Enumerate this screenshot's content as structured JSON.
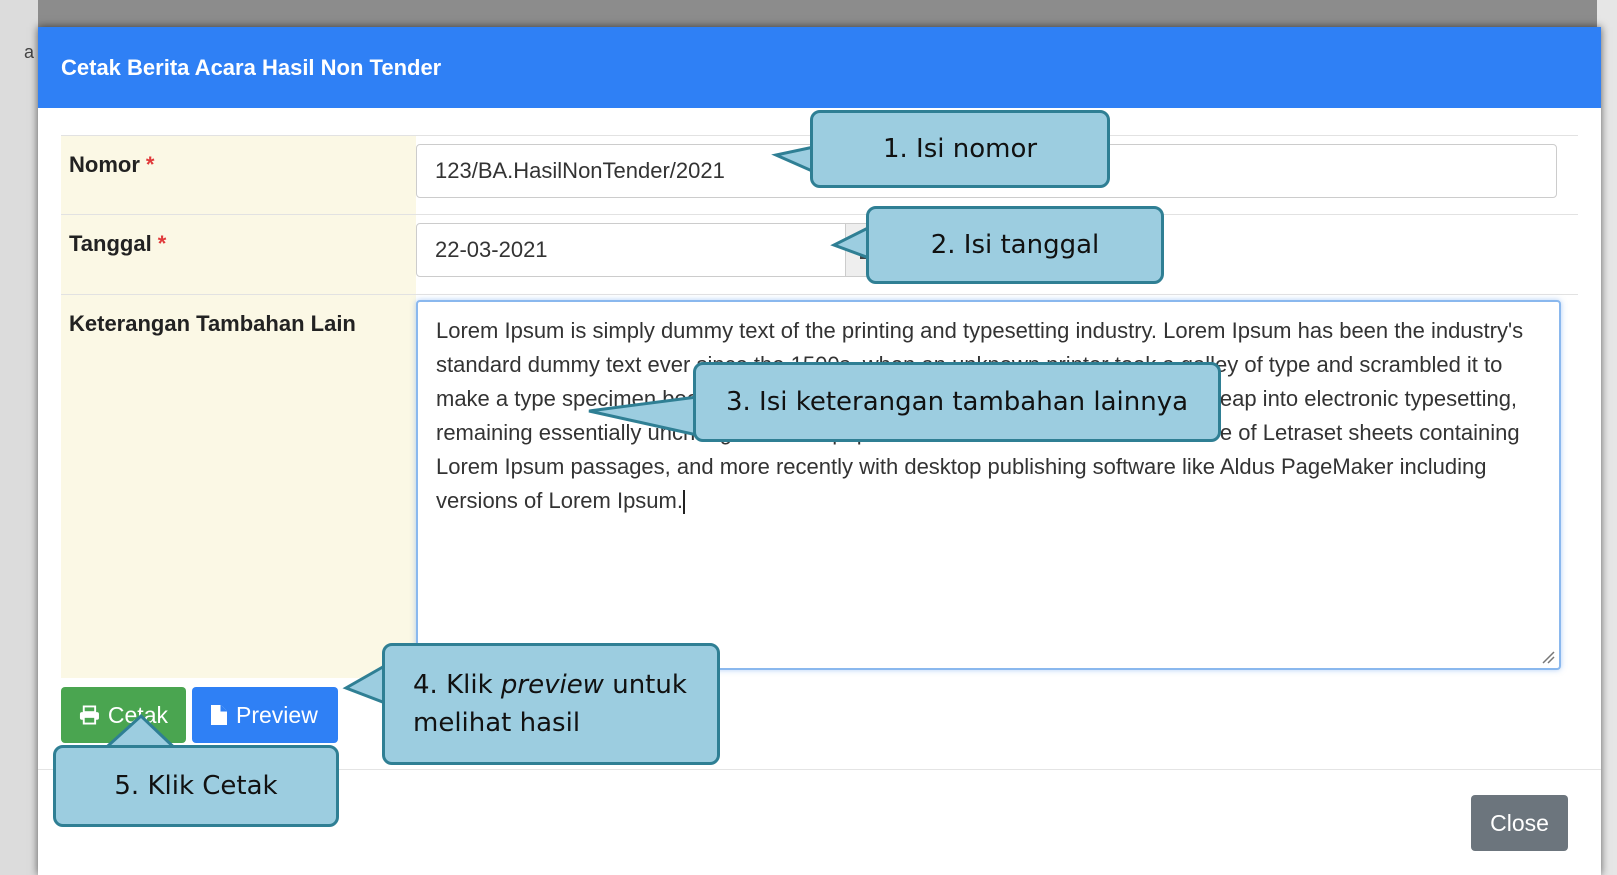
{
  "backdrop": {
    "letter": "a"
  },
  "modal": {
    "title": "Cetak Berita Acara Hasil Non Tender",
    "fields": {
      "nomor": {
        "label": "Nomor",
        "required_mark": "*",
        "value": "123/BA.HasilNonTender/2021"
      },
      "tanggal": {
        "label": "Tanggal",
        "required_mark": "*",
        "value": "22-03-2021",
        "icon": "calendar-icon"
      },
      "keterangan": {
        "label": "Keterangan Tambahan Lain",
        "value": "Lorem Ipsum is simply dummy text of the printing and typesetting industry. Lorem Ipsum has been the industry's standard dummy text ever since the 1500s, when an unknown printer took a galley of type and scrambled it to make a type specimen book. It has survived not only five centuries, but also the leap into electronic typesetting, remaining essentially unchanged. It was popularised in the 1960s with the release of Letraset sheets containing Lorem Ipsum passages, and more recently with desktop publishing software like Aldus PageMaker including versions of Lorem Ipsum."
      }
    },
    "buttons": {
      "cetak": {
        "label": "Cetak",
        "icon": "print-icon",
        "color": "#4aa550"
      },
      "preview": {
        "label": "Preview",
        "icon": "file-icon",
        "color": "#2f80f5"
      },
      "close": {
        "label": "Close",
        "color": "#6c757d"
      }
    },
    "header_color": "#2f80f5"
  },
  "callouts": {
    "c1": "1. Isi nomor",
    "c2": "2. Isi tanggal",
    "c3": "3. Isi keterangan tambahan lainnya",
    "c4_prefix": "4. Klik ",
    "c4_em": "preview",
    "c4_suffix": " untuk",
    "c4_line2": "melihat hasil",
    "c5": "5. Klik Cetak"
  }
}
